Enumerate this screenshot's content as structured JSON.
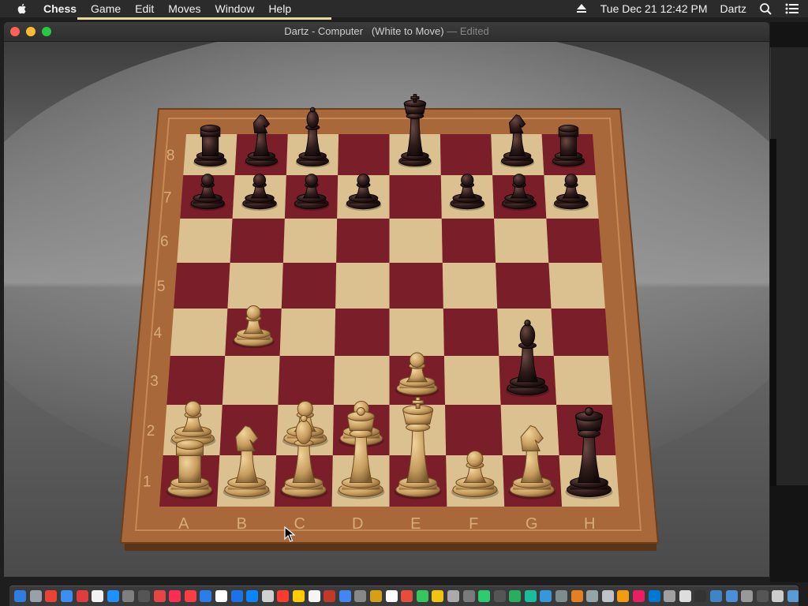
{
  "menubar": {
    "items": [
      "Chess",
      "Game",
      "Edit",
      "Moves",
      "Window",
      "Help"
    ],
    "date": "Tue Dec 21",
    "time": "12:42 PM",
    "user": "Dartz"
  },
  "window": {
    "title": "Dartz - Computer",
    "status": "(White to Move)",
    "edited": "— Edited"
  },
  "board": {
    "files": [
      "A",
      "B",
      "C",
      "D",
      "E",
      "F",
      "G",
      "H"
    ],
    "ranks": [
      "8",
      "7",
      "6",
      "5",
      "4",
      "3",
      "2",
      "1"
    ],
    "colors": {
      "light_square": "#dcc190",
      "dark_square": "#7a1f2a",
      "frame": "#a8683a",
      "white_piece": "#c79c5e",
      "black_piece": "#2f1c1a"
    },
    "pieces": [
      {
        "sq": "a8",
        "t": "rook",
        "c": "black"
      },
      {
        "sq": "b8",
        "t": "knight",
        "c": "black"
      },
      {
        "sq": "c8",
        "t": "bishop",
        "c": "black"
      },
      {
        "sq": "e8",
        "t": "king",
        "c": "black"
      },
      {
        "sq": "g8",
        "t": "knight",
        "c": "black"
      },
      {
        "sq": "h8",
        "t": "rook",
        "c": "black"
      },
      {
        "sq": "a7",
        "t": "pawn",
        "c": "black"
      },
      {
        "sq": "b7",
        "t": "pawn",
        "c": "black"
      },
      {
        "sq": "c7",
        "t": "pawn",
        "c": "black"
      },
      {
        "sq": "d7",
        "t": "pawn",
        "c": "black"
      },
      {
        "sq": "f7",
        "t": "pawn",
        "c": "black"
      },
      {
        "sq": "g7",
        "t": "pawn",
        "c": "black"
      },
      {
        "sq": "h7",
        "t": "pawn",
        "c": "black"
      },
      {
        "sq": "b4",
        "t": "pawn",
        "c": "white"
      },
      {
        "sq": "e3",
        "t": "pawn",
        "c": "white"
      },
      {
        "sq": "g3",
        "t": "bishop",
        "c": "black"
      },
      {
        "sq": "a2",
        "t": "pawn",
        "c": "white"
      },
      {
        "sq": "c2",
        "t": "pawn",
        "c": "white"
      },
      {
        "sq": "d2",
        "t": "pawn",
        "c": "white"
      },
      {
        "sq": "a1",
        "t": "rook",
        "c": "white"
      },
      {
        "sq": "b1",
        "t": "knight",
        "c": "white"
      },
      {
        "sq": "c1",
        "t": "bishop",
        "c": "white"
      },
      {
        "sq": "d1",
        "t": "queen",
        "c": "white"
      },
      {
        "sq": "e1",
        "t": "king",
        "c": "white"
      },
      {
        "sq": "f1",
        "t": "pawn",
        "c": "white"
      },
      {
        "sq": "g1",
        "t": "knight",
        "c": "white"
      },
      {
        "sq": "h1",
        "t": "queen",
        "c": "black"
      }
    ]
  },
  "dock": {
    "colors": [
      "#2f7de1",
      "#9aa0a8",
      "#ea4335",
      "#3b8ff0",
      "#e03c3c",
      "#f2f2f2",
      "#1e90ff",
      "#7f7f7f",
      "#555555",
      "#e64545",
      "#ff2d55",
      "#fc3c44",
      "#2b7de9",
      "#ffffff",
      "#1a73e8",
      "#0a84ff",
      "#d0d0d0",
      "#ff3b30",
      "#ffcc00",
      "#f5f5f5",
      "#c0392b",
      "#4285f4",
      "#888888",
      "#d4a017",
      "#ffffff",
      "#e74c3c",
      "#34c759",
      "#f1c40f",
      "#aaaaaa",
      "#7a7a7a",
      "#2ecc71",
      "#555555",
      "#27ae60",
      "#1abc9c",
      "#3498db",
      "#7f8c8d",
      "#e67e22",
      "#95a5a6",
      "#bdc3c7",
      "#f39c12",
      "#e91e63",
      "#0078d7",
      "#a0a0a0",
      "#dddddd",
      "#333333",
      "#3d85c6",
      "#4a90d9",
      "#999999",
      "#555555",
      "#cccccc",
      "#5b9bd5",
      "#eeeeee",
      "#ff0000",
      "#777777"
    ]
  }
}
